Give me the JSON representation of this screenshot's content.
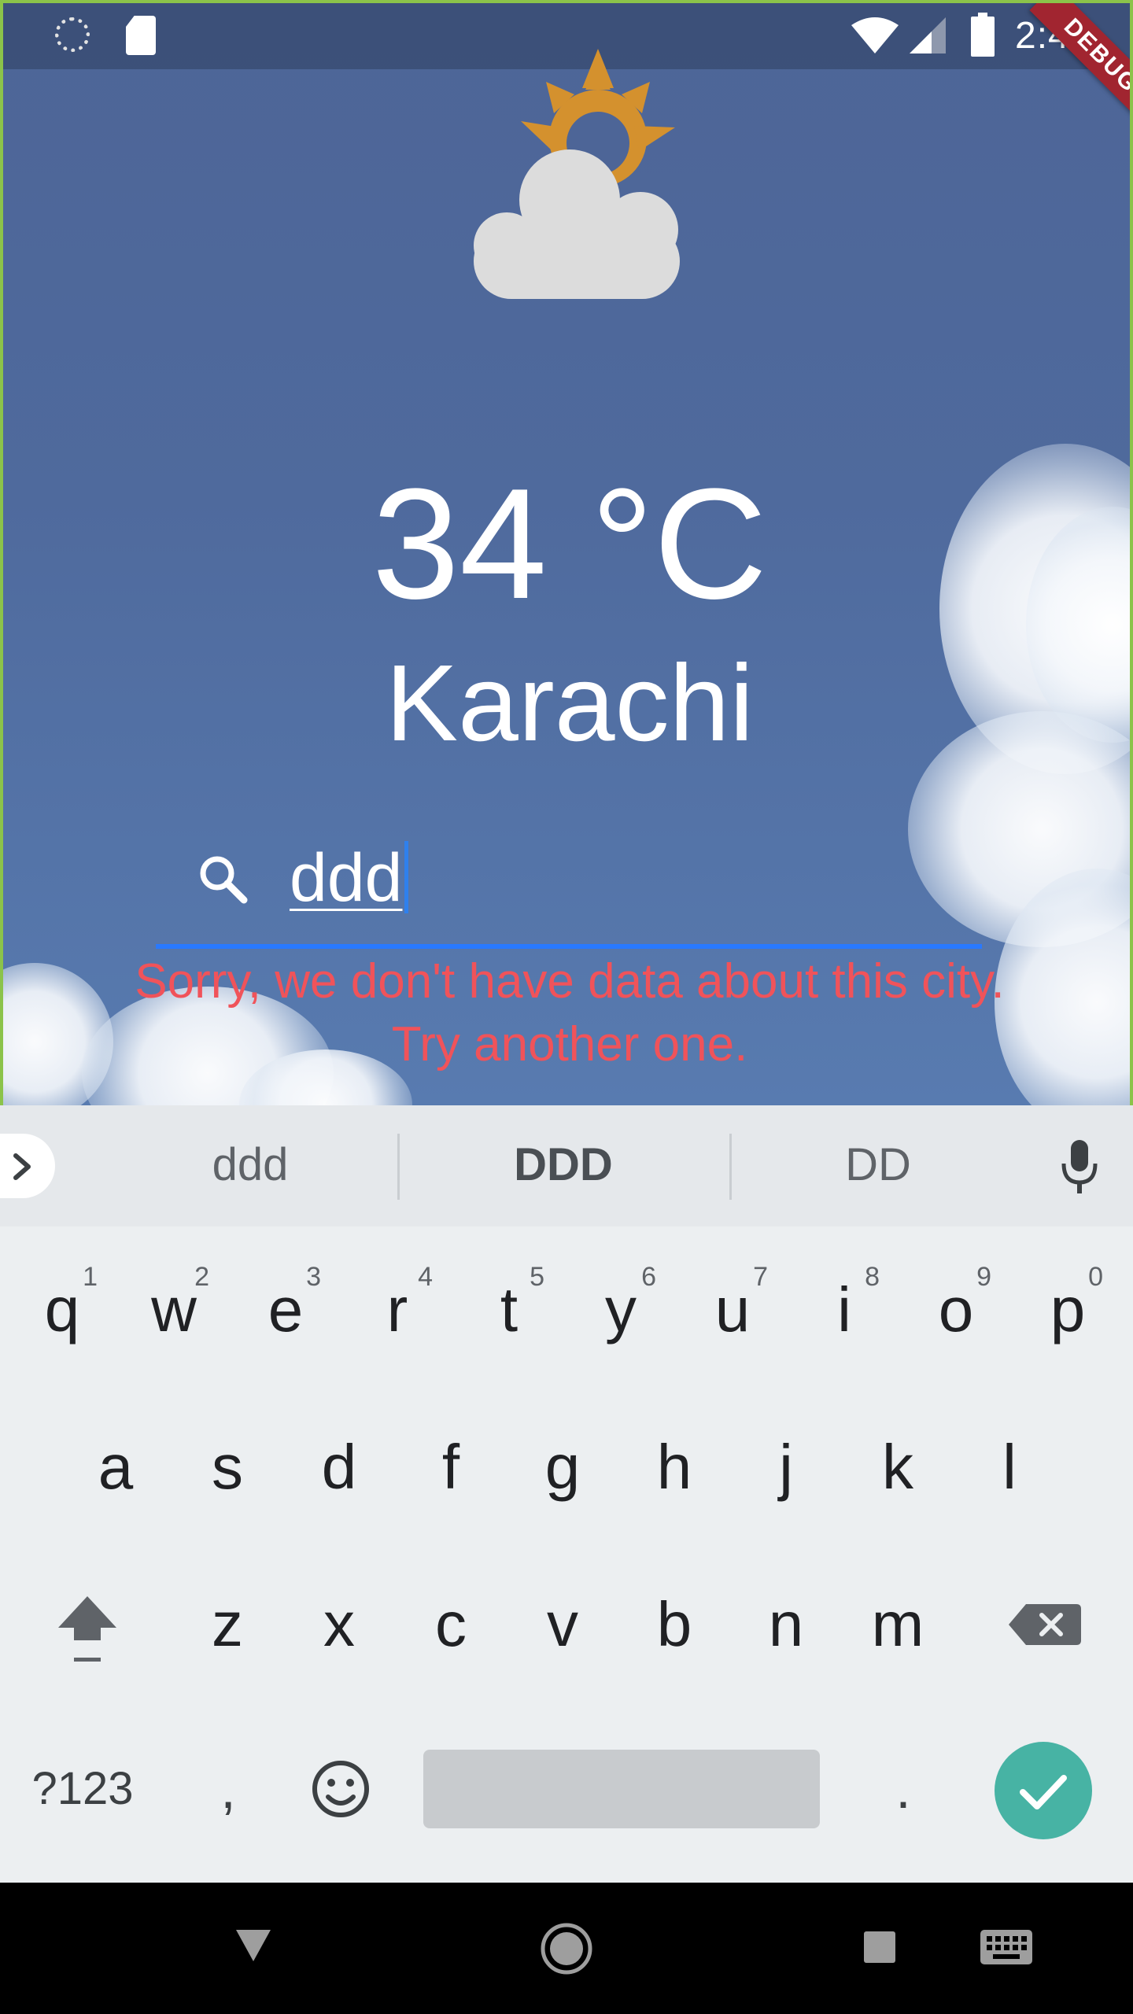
{
  "status_bar": {
    "time": "2:49",
    "icons": [
      "sync-icon",
      "sd-card-icon",
      "wifi-icon",
      "cellular-signal-icon",
      "battery-icon"
    ]
  },
  "debug_banner": {
    "label": "DEBUG"
  },
  "weather": {
    "icon": "partly-cloudy-icon",
    "temperature": "34 °C",
    "city": "Karachi"
  },
  "search": {
    "icon": "search-icon",
    "value": "ddd",
    "error": "Sorry, we don't have data about this city. Try another one."
  },
  "keyboard": {
    "suggestions": [
      "ddd",
      "DDD",
      "DD"
    ],
    "row1": [
      {
        "key": "q",
        "hint": "1"
      },
      {
        "key": "w",
        "hint": "2"
      },
      {
        "key": "e",
        "hint": "3"
      },
      {
        "key": "r",
        "hint": "4"
      },
      {
        "key": "t",
        "hint": "5"
      },
      {
        "key": "y",
        "hint": "6"
      },
      {
        "key": "u",
        "hint": "7"
      },
      {
        "key": "i",
        "hint": "8"
      },
      {
        "key": "o",
        "hint": "9"
      },
      {
        "key": "p",
        "hint": "0"
      }
    ],
    "row2": [
      "a",
      "s",
      "d",
      "f",
      "g",
      "h",
      "j",
      "k",
      "l"
    ],
    "row3": [
      "z",
      "x",
      "c",
      "v",
      "b",
      "n",
      "m"
    ],
    "symbols_label": "?123",
    "comma": ",",
    "period": ".",
    "colors": {
      "background": "#eceff1",
      "enter": "#47b3a4",
      "error": "#f0535a",
      "accent": "#2979ff"
    }
  },
  "nav_bar": {
    "icons": [
      "back-icon",
      "home-icon",
      "recents-icon",
      "keyboard-switch-icon"
    ]
  }
}
